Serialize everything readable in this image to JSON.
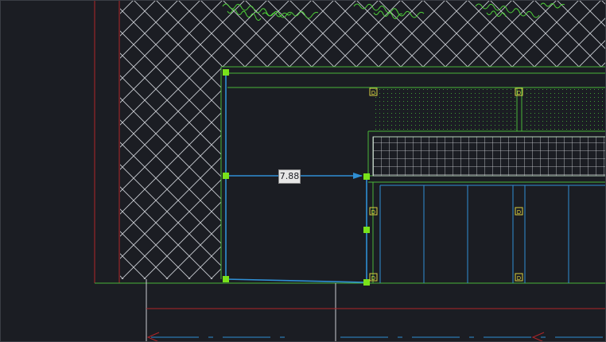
{
  "app": "CAD drawing viewport",
  "dimension": {
    "value": "7.88"
  },
  "colors": {
    "background": "#1b1d23",
    "hatch": "#c9ccd2",
    "green_lines": "#49b53a",
    "red_lines": "#b0262a",
    "blue_lines": "#2f8fd4",
    "grips": "#79e21a",
    "yellow_markers": "#d8d040",
    "vegetation": "#4fd33a"
  },
  "markers": {
    "d_symbol": "D"
  }
}
